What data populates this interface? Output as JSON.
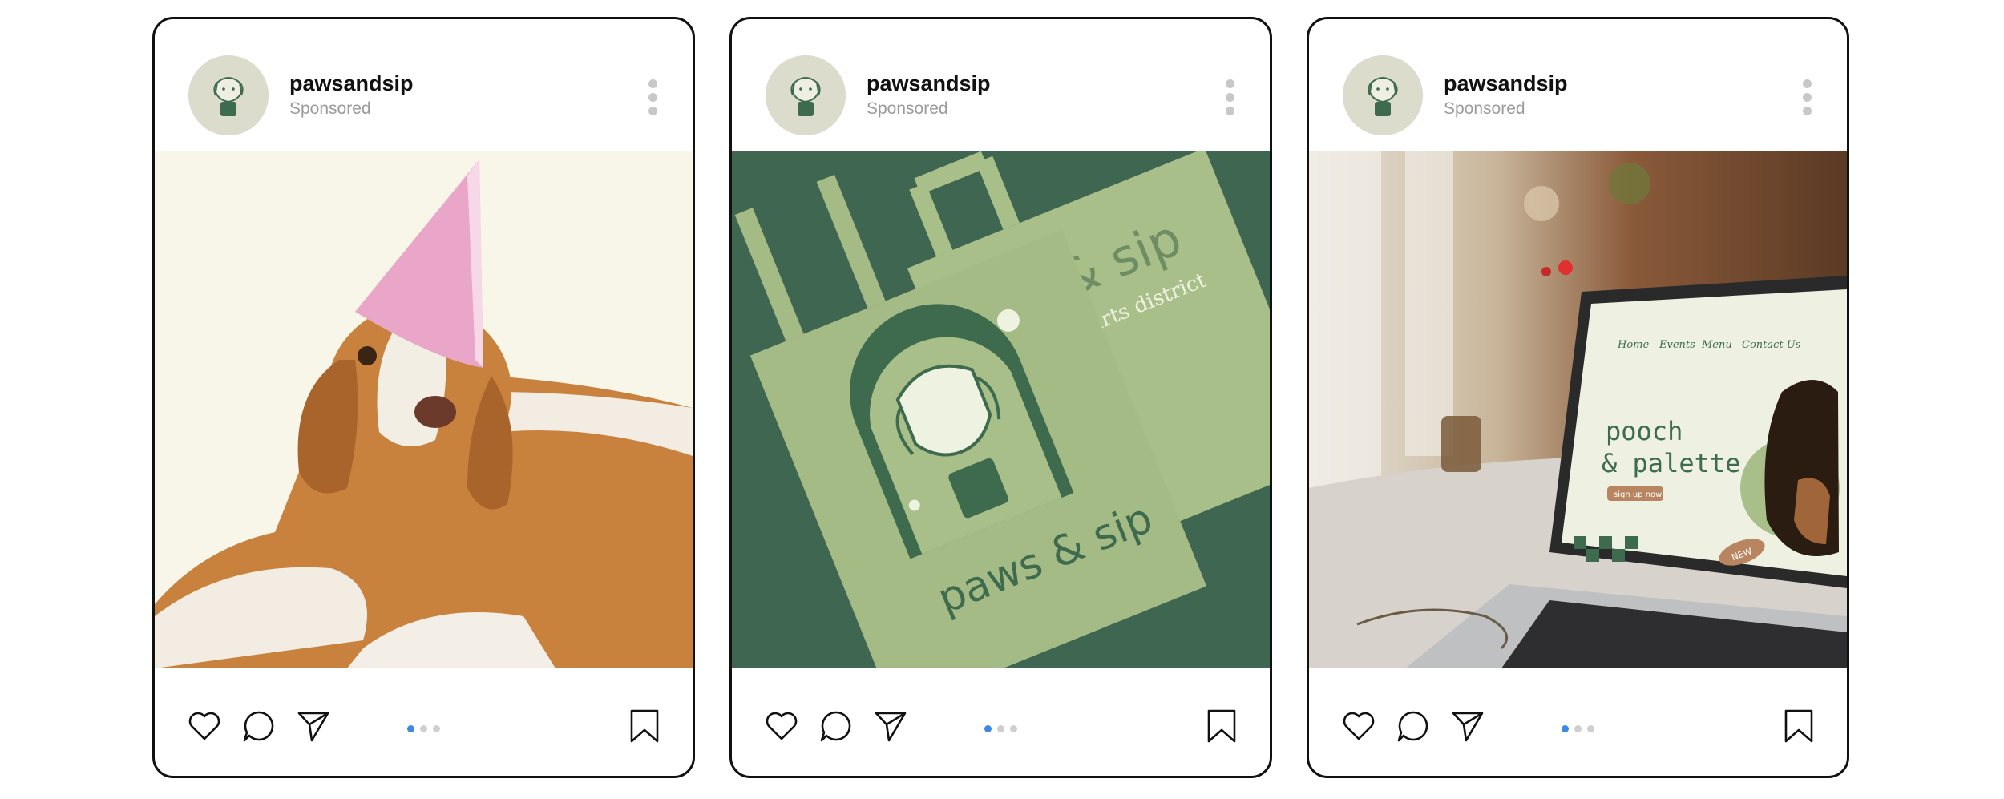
{
  "posts": [
    {
      "username": "pawsandsip",
      "sponsored": "Sponsored",
      "image": "dog-party-hat-photo"
    },
    {
      "username": "pawsandsip",
      "sponsored": "Sponsored",
      "image": "tote-bags-photo",
      "tote_logo_text": "paws & sip",
      "back_tote_text": "s & sip",
      "back_tote_sub": "rk, arts district"
    },
    {
      "username": "pawsandsip",
      "sponsored": "Sponsored",
      "image": "laptop-cafe-photo",
      "site_nav": [
        "Home",
        "Events",
        "Menu",
        "Contact Us"
      ],
      "site_heading_1": "pooch",
      "site_heading_2": "& palette",
      "site_button": "sign up now",
      "site_badge": "NEW"
    }
  ],
  "icons": {
    "like": "heart-icon",
    "comment": "comment-icon",
    "share": "paper-plane-icon",
    "save": "bookmark-icon",
    "more": "more-vertical-icon"
  },
  "colors": {
    "carousel_active": "#3d8ae0",
    "carousel_inactive": "#cfcfcf",
    "brand_green": "#3e6a4e",
    "brand_sage": "#a9bf8a"
  },
  "carousel": {
    "total": 3,
    "active_index": 0
  }
}
